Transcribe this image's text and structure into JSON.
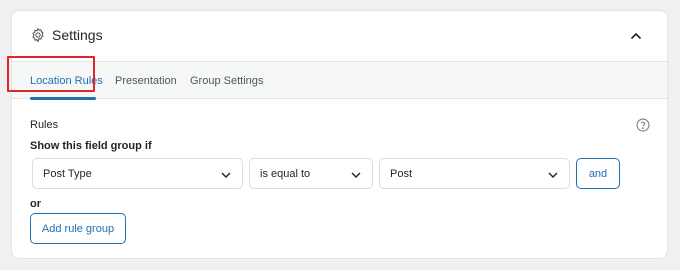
{
  "panel": {
    "title": "Settings",
    "icon": "gear-icon",
    "collapse_icon": "chevron-up-icon"
  },
  "tabs": [
    {
      "label": "Location Rules",
      "active": true
    },
    {
      "label": "Presentation",
      "active": false
    },
    {
      "label": "Group Settings",
      "active": false
    }
  ],
  "rules": {
    "section_label": "Rules",
    "condition_label": "Show this field group if",
    "param_select": "Post Type",
    "operator_select": "is equal to",
    "value_select": "Post",
    "and_button": "and",
    "or_label": "or",
    "add_group_button": "Add rule group",
    "help_icon": "question-circle-icon"
  },
  "colors": {
    "accent": "#2271b1",
    "highlight": "#e0262d",
    "background": "#f0f0f1",
    "tabbar": "#f6f7f7"
  }
}
